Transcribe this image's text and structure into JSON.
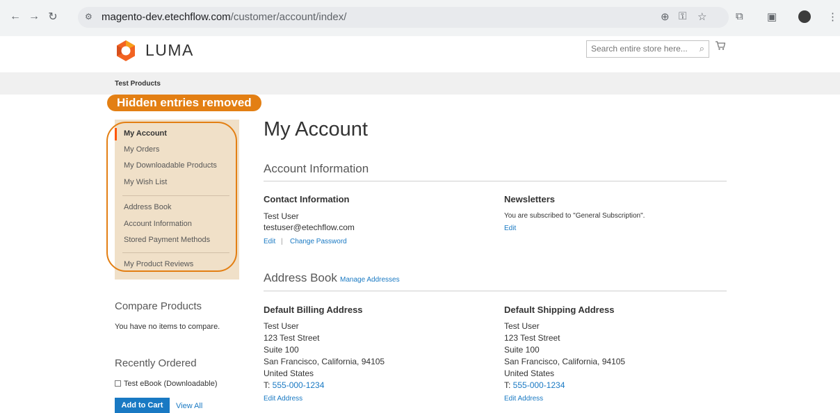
{
  "browser": {
    "url_host": "magento-dev.etechflow.com",
    "url_path": "/customer/account/index/"
  },
  "header": {
    "logo_text": "LUMA",
    "search_placeholder": "Search entire store here..."
  },
  "category_bar": {
    "label": "Test Products"
  },
  "callout": {
    "text": "Hidden entries removed"
  },
  "sidebar": {
    "items": [
      {
        "label": "My Account",
        "current": true
      },
      {
        "label": "My Orders"
      },
      {
        "label": "My Downloadable Products"
      },
      {
        "label": "My Wish List"
      },
      {
        "label": "Address Book"
      },
      {
        "label": "Account Information"
      },
      {
        "label": "Stored Payment Methods"
      },
      {
        "label": "My Product Reviews"
      }
    ]
  },
  "compare": {
    "title": "Compare Products",
    "empty_text": "You have no items to compare."
  },
  "recently_ordered": {
    "title": "Recently Ordered",
    "item": "Test eBook (Downloadable)",
    "add_to_cart": "Add to Cart",
    "view_all": "View All"
  },
  "main": {
    "page_title": "My Account",
    "account_info": {
      "title": "Account Information",
      "contact": {
        "title": "Contact Information",
        "name": "Test User",
        "email": "testuser@etechflow.com",
        "edit": "Edit",
        "separator": "|",
        "change_password": "Change Password"
      },
      "newsletters": {
        "title": "Newsletters",
        "text": "You are subscribed to \"General Subscription\".",
        "edit": "Edit"
      }
    },
    "address_book": {
      "title": "Address Book",
      "manage": "Manage Addresses",
      "billing": {
        "title": "Default Billing Address",
        "name": "Test User",
        "street": "123 Test Street",
        "suite": "Suite 100",
        "city": "San Francisco, California, 94105",
        "country": "United States",
        "phone_prefix": "T: ",
        "phone": "555-000-1234",
        "edit": "Edit Address"
      },
      "shipping": {
        "title": "Default Shipping Address",
        "name": "Test User",
        "street": "123 Test Street",
        "suite": "Suite 100",
        "city": "San Francisco, California, 94105",
        "country": "United States",
        "phone_prefix": "T: ",
        "phone": "555-000-1234",
        "edit": "Edit Address"
      }
    }
  },
  "colors": {
    "accent": "#1979c3",
    "callout": "#e37f13",
    "sidebar_bg": "#f0e0c8",
    "current_marker": "#ff5501"
  }
}
